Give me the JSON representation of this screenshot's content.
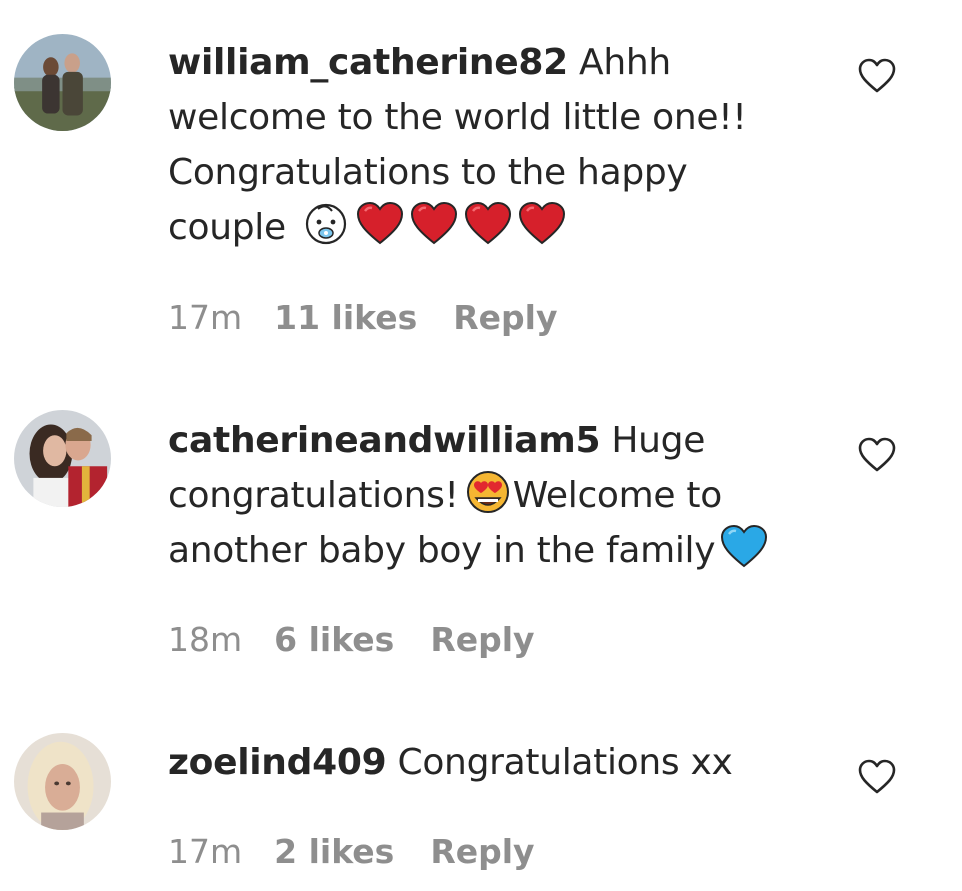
{
  "comments": [
    {
      "username": "william_catherine82",
      "text": "Ahhh welcome to the world little one!! Congratulations to the happy couple",
      "emojis": [
        "baby-face-emoji",
        "red-heart-emoji",
        "red-heart-emoji",
        "red-heart-emoji",
        "red-heart-emoji"
      ],
      "time": "17m",
      "likes": "11 likes",
      "reply": "Reply"
    },
    {
      "username": "catherineandwilliam5",
      "text_a": "Huge congratulations!",
      "text_b": "Welcome to another baby boy in the family",
      "emojis": [
        "heart-eyes-emoji",
        "blue-heart-emoji"
      ],
      "time": "18m",
      "likes": "6 likes",
      "reply": "Reply"
    },
    {
      "username": "zoelind409",
      "text": "Congratulations xx",
      "time": "17m",
      "likes": "2 likes",
      "reply": "Reply"
    }
  ],
  "icons": {
    "like": "heart-outline-icon"
  },
  "colors": {
    "text": "#262626",
    "meta": "#8e8e8e",
    "heart_red": "#d6202b",
    "heart_blue": "#2aa8e6"
  }
}
